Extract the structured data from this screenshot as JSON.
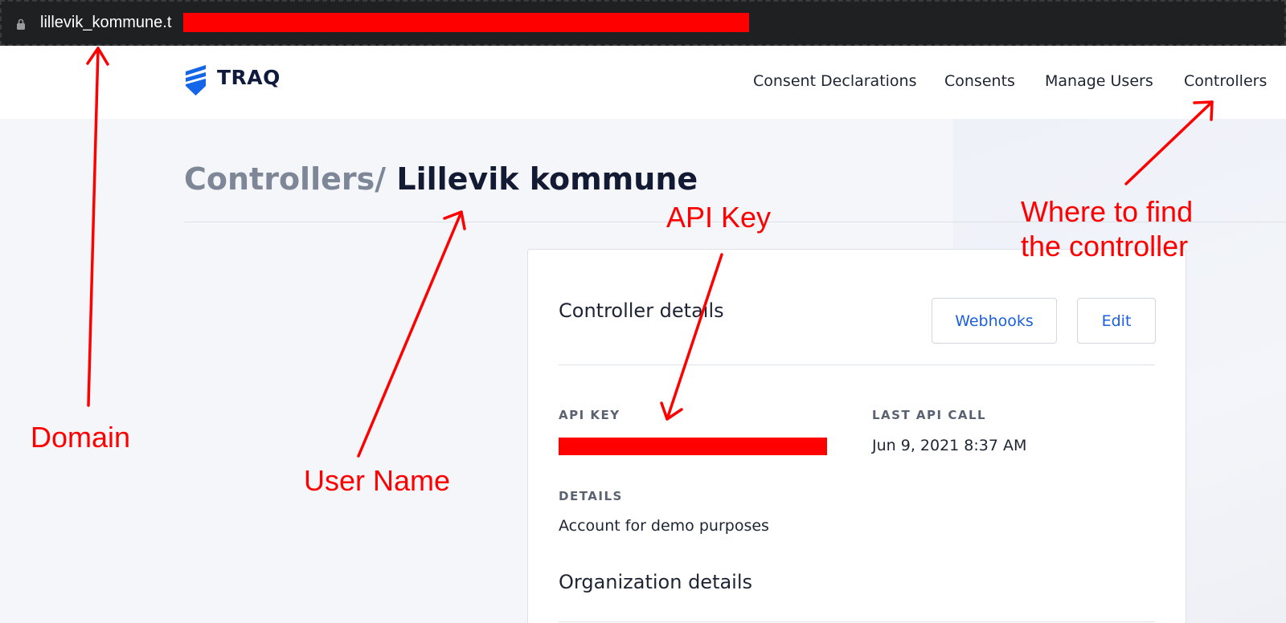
{
  "browser": {
    "url_text": "lillevik_kommune.t",
    "url_redaction": "redacted",
    "lock_icon": "lock-icon"
  },
  "nav": {
    "brand": "TRAQ",
    "logo_icon": "traq-shield-logo",
    "links": [
      "Consent Declarations",
      "Consents",
      "Manage Users",
      "Controllers"
    ]
  },
  "breadcrumb": {
    "parent": "Controllers/",
    "current": "Lillevik kommune"
  },
  "card": {
    "title": "Controller details",
    "buttons": {
      "webhooks": "Webhooks",
      "edit": "Edit"
    },
    "fields": {
      "api_key_label": "API KEY",
      "api_key_value": "redacted",
      "last_api_call_label": "LAST API CALL",
      "last_api_call_value": "Jun 9, 2021 8:37 AM",
      "details_label": "DETAILS",
      "details_value": "Account for demo purposes"
    },
    "section_title": "Organization details"
  },
  "annotations": {
    "domain": "Domain",
    "user_name": "User Name",
    "api_key": "API Key",
    "where_line1": "Where to find",
    "where_line2": "the controller"
  },
  "colors": {
    "annotation": "#ff0000",
    "accent_link": "#1a5fe0",
    "brand_blue": "#1366e8"
  }
}
